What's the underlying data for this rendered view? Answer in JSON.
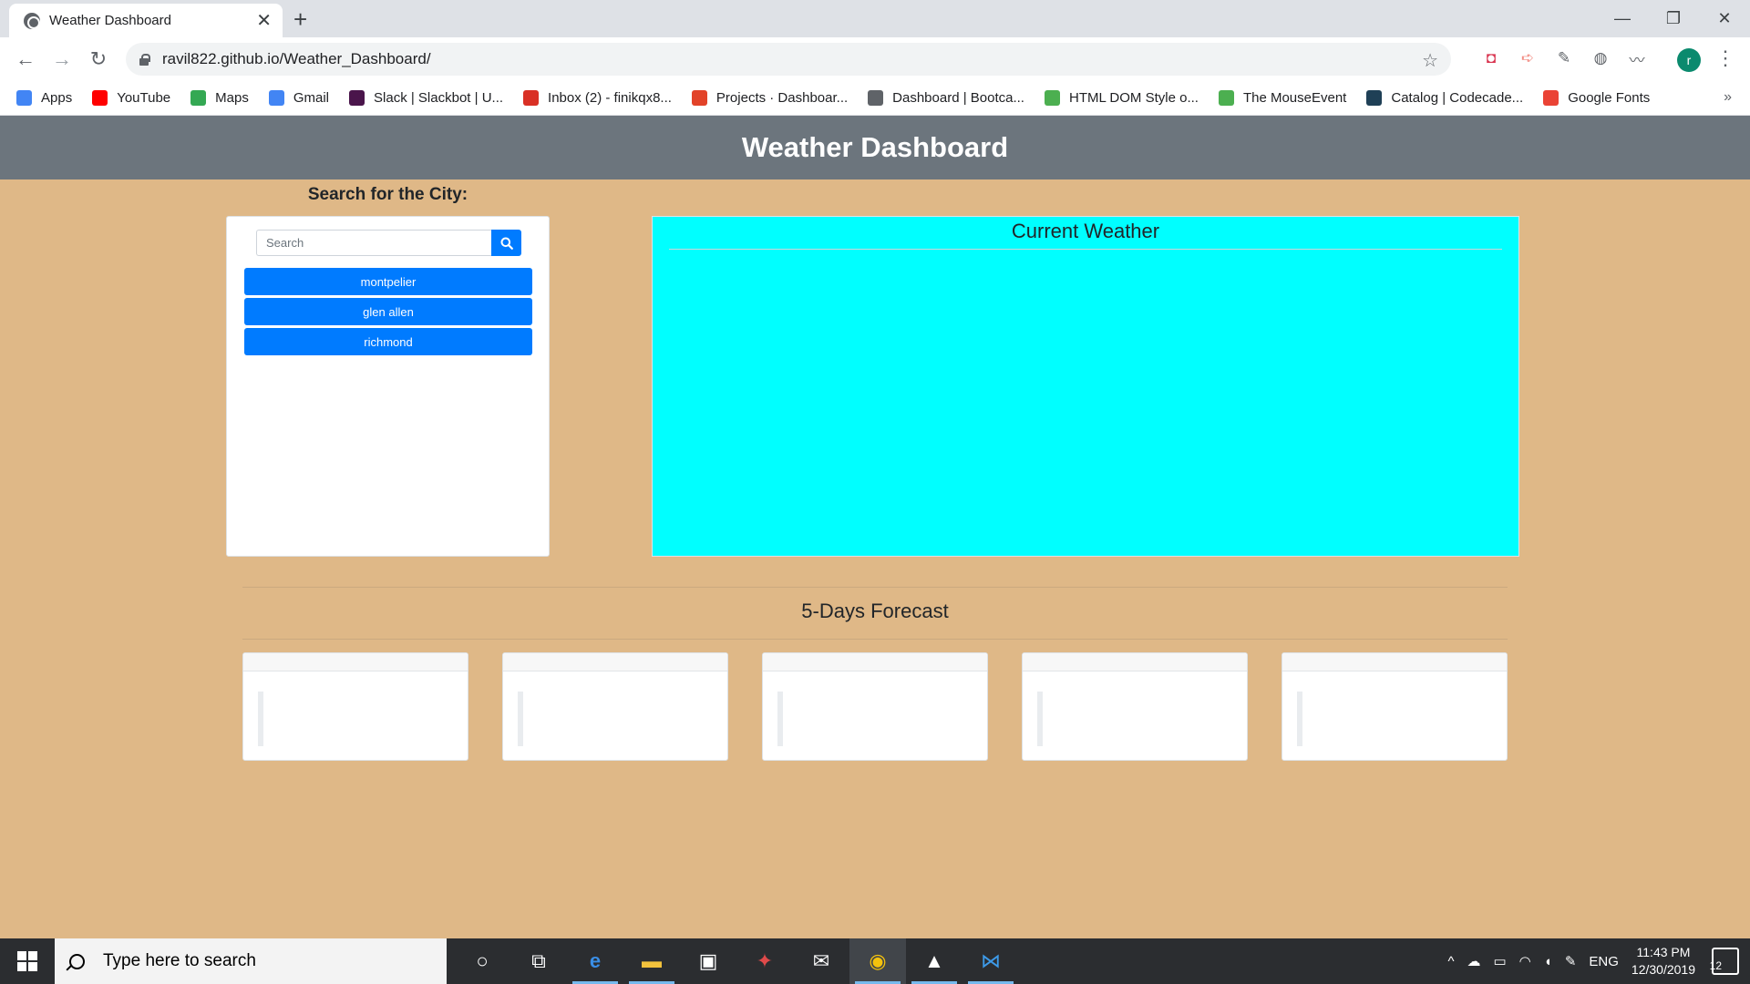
{
  "browser": {
    "tab_title": "Weather Dashboard",
    "tab_close": "✕",
    "new_tab": "+",
    "url": "ravil822.github.io/Weather_Dashboard/",
    "back": "←",
    "forward": "→",
    "reload": "↻",
    "star": "☆",
    "minimize": "—",
    "maximize": "❐",
    "close": "✕",
    "profile_initial": "r",
    "menu": "⋮",
    "bookmarks": [
      {
        "label": "Apps",
        "icon": "apps-grid-icon",
        "color": "#4285f4"
      },
      {
        "label": "YouTube",
        "icon": "youtube-icon",
        "color": "#ff0000"
      },
      {
        "label": "Maps",
        "icon": "maps-icon",
        "color": "#34a853"
      },
      {
        "label": "Gmail",
        "icon": "google-icon",
        "color": "#4285f4"
      },
      {
        "label": "Slack | Slackbot | U...",
        "icon": "slack-icon",
        "color": "#4a154b"
      },
      {
        "label": "Inbox (2) - finikqx8...",
        "icon": "gmail-icon",
        "color": "#d93025"
      },
      {
        "label": "Projects · Dashboar...",
        "icon": "gitlab-icon",
        "color": "#e24329"
      },
      {
        "label": "Dashboard | Bootca...",
        "icon": "globe-icon",
        "color": "#5f6368"
      },
      {
        "label": "HTML DOM Style o...",
        "icon": "w3schools-icon",
        "color": "#4caf50"
      },
      {
        "label": "The MouseEvent",
        "icon": "w3schools-icon",
        "color": "#4caf50"
      },
      {
        "label": "Catalog | Codecade...",
        "icon": "codecademy-icon",
        "color": "#1f4056"
      },
      {
        "label": "Google Fonts",
        "icon": "google-fonts-icon",
        "color": "#ea4335"
      }
    ],
    "bookmarks_more": "»"
  },
  "page": {
    "header_title": "Weather Dashboard",
    "search_title": "Search for the City:",
    "search_placeholder": "Search",
    "search_value": "",
    "cities": [
      "montpelier",
      "glen allen",
      "richmond"
    ],
    "current_title": "Current Weather",
    "forecast_title": "5-Days Forecast",
    "colors": {
      "header_bg": "#6c757d",
      "page_bg": "#dfb887",
      "accent": "#007bff",
      "current_bg": "#00ffff"
    }
  },
  "taskbar": {
    "search_placeholder": "Type here to search",
    "apps": [
      "cortana-icon",
      "task-view-icon",
      "edge-icon",
      "file-explorer-icon",
      "store-icon",
      "gift-icon",
      "mail-icon",
      "chrome-icon",
      "photos-icon",
      "vscode-icon"
    ],
    "language": "ENG",
    "time": "11:43 PM",
    "date": "12/30/2019",
    "notifications": "12"
  }
}
